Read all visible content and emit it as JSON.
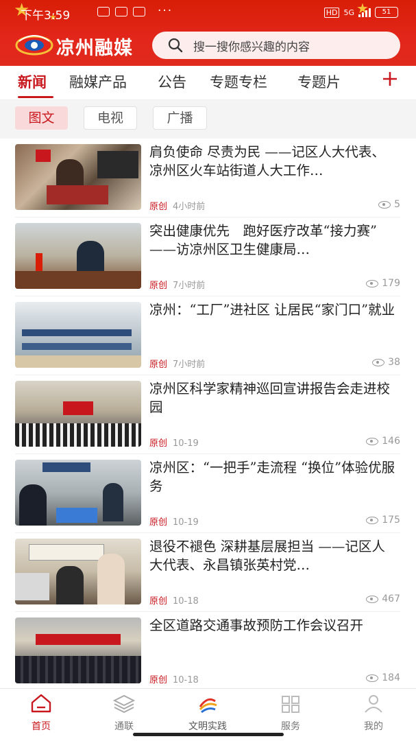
{
  "status_bar": {
    "time": "下午3:59",
    "network": "5G",
    "battery": "51"
  },
  "header": {
    "brand": "凉州融媒",
    "search_placeholder": "搜一搜你感兴趣的内容"
  },
  "tabs": [
    "新闻",
    "融媒产品",
    "公告",
    "专题专栏",
    "专题片"
  ],
  "subtabs": [
    "图文",
    "电视",
    "广播"
  ],
  "articles": [
    {
      "title": "肩负使命  尽责为民  ——记区人大代表、凉州区火车站街道人大工作…",
      "tag": "原创",
      "time": "4小时前",
      "views": "5"
    },
    {
      "title": "突出健康优先　跑好医疗改革“接力赛”　——访凉州区卫生健康局…",
      "tag": "原创",
      "time": "7小时前",
      "views": "179"
    },
    {
      "title": "凉州：“工厂”进社区  让居民“家门口”就业",
      "tag": "原创",
      "time": "7小时前",
      "views": "38"
    },
    {
      "title": "凉州区科学家精神巡回宣讲报告会走进校园",
      "tag": "原创",
      "time": "10-19",
      "views": "146"
    },
    {
      "title": "凉州区：“一把手”走流程  “换位”体验优服务",
      "tag": "原创",
      "time": "10-19",
      "views": "175"
    },
    {
      "title": "退役不褪色  深耕基层展担当  ——记区人大代表、永昌镇张英村党…",
      "tag": "原创",
      "time": "10-18",
      "views": "467"
    },
    {
      "title": "全区道路交通事故预防工作会议召开",
      "tag": "原创",
      "time": "10-18",
      "views": "184"
    }
  ],
  "bottom_nav": [
    "首页",
    "通联",
    "文明实践",
    "服务",
    "我的"
  ],
  "colors": {
    "primary": "#c9171e",
    "header": "#e0251a"
  }
}
